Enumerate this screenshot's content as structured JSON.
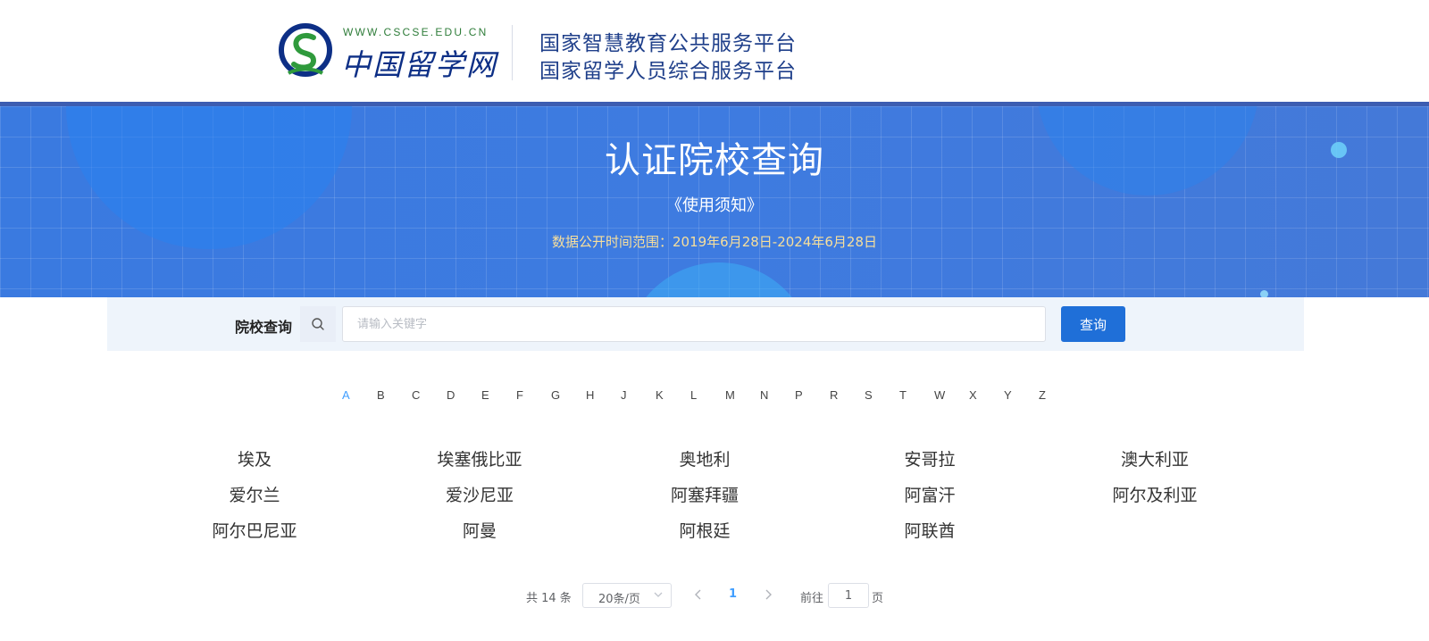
{
  "header": {
    "logo_url_text": "WWW.CSCSE.EDU.CN",
    "logo_name": "中国留学网",
    "platform_line1": "国家智慧教育公共服务平台",
    "platform_line2": "国家留学人员综合服务平台"
  },
  "banner": {
    "title": "认证院校查询",
    "notice_link": "《使用须知》",
    "data_range": "数据公开时间范围：2019年6月28日-2024年6月28日"
  },
  "search": {
    "label": "院校查询",
    "placeholder": "请输入关键字",
    "value": "",
    "button_label": "查询"
  },
  "letters": {
    "active": "A",
    "items": [
      "A",
      "B",
      "C",
      "D",
      "E",
      "F",
      "G",
      "H",
      "J",
      "K",
      "L",
      "M",
      "N",
      "P",
      "R",
      "S",
      "T",
      "W",
      "X",
      "Y",
      "Z"
    ]
  },
  "countries": [
    "埃及",
    "埃塞俄比亚",
    "奥地利",
    "安哥拉",
    "澳大利亚",
    "爱尔兰",
    "爱沙尼亚",
    "阿塞拜疆",
    "阿富汗",
    "阿尔及利亚",
    "阿尔巴尼亚",
    "阿曼",
    "阿根廷",
    "阿联酋"
  ],
  "pagination": {
    "total_text": "共 14 条",
    "page_size": "20条/页",
    "current_page": "1",
    "goto_prefix": "前往",
    "goto_value": "1",
    "goto_suffix": "页"
  },
  "colors": {
    "brand_blue": "#1f6fd8",
    "active_letter": "#409eff",
    "range_text": "#f7df9c"
  },
  "icons": {
    "search": "search-icon",
    "prev": "chevron-left-icon",
    "next": "chevron-right-icon",
    "dropdown": "chevron-down-icon"
  }
}
